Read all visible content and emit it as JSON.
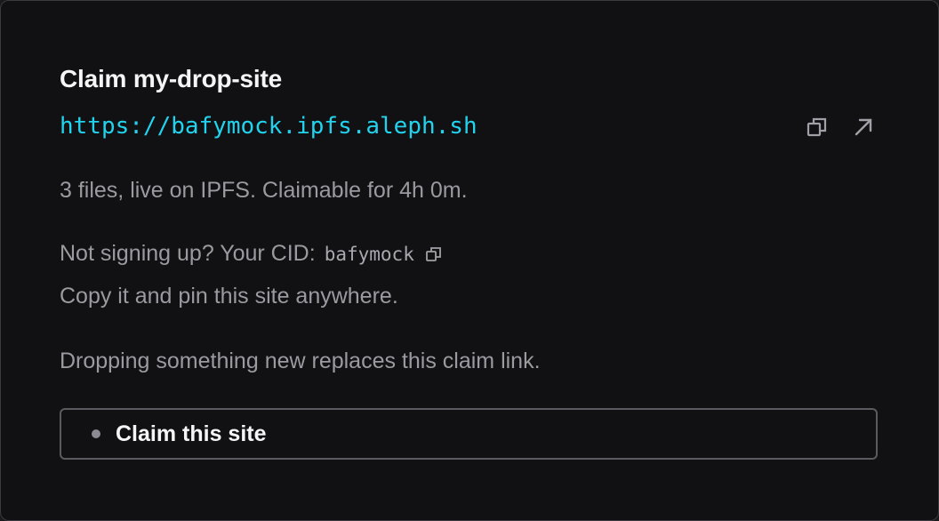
{
  "card": {
    "title": "Claim my-drop-site",
    "url": "https://bafymock.ipfs.aleph.sh",
    "info": "3 files, live on IPFS. Claimable for 4h 0m.",
    "cid_prefix": "Not signing up? Your CID:",
    "cid_value": "bafymock",
    "copy_hint": "Copy it and pin this site anywhere.",
    "drop_note": "Dropping something new replaces this claim link.",
    "claim_button_label": "Claim this site"
  },
  "icons": {
    "copy_url": "copy-icon",
    "open_url": "external-link-icon",
    "copy_cid": "copy-icon",
    "claim_status": "status-dot-icon"
  },
  "colors": {
    "accent": "#22d3ee",
    "background": "#111114",
    "text_primary": "#f5f5f5",
    "text_secondary": "#9a9aa0"
  }
}
